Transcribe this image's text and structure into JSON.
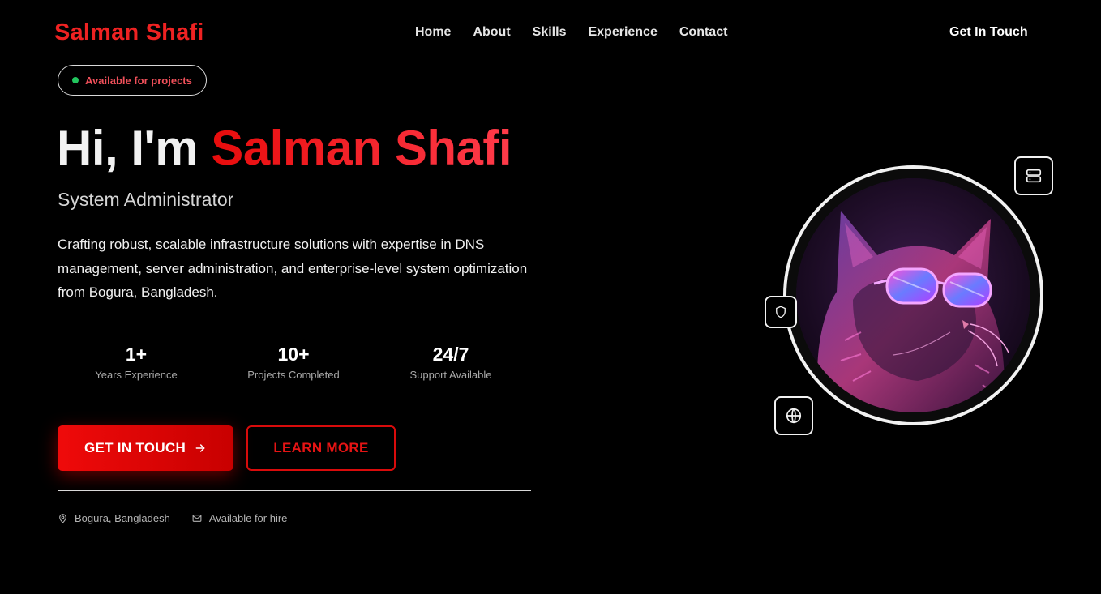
{
  "header": {
    "logo": "Salman Shafi",
    "nav": [
      "Home",
      "About",
      "Skills",
      "Experience",
      "Contact"
    ],
    "cta": "Get In Touch"
  },
  "badge": {
    "text": "Available for projects",
    "dot_color": "#22c55e"
  },
  "hero": {
    "greeting": "Hi, I'm ",
    "name": "Salman Shafi",
    "role": "System Administrator",
    "description": "Crafting robust, scalable infrastructure solutions with expertise in DNS management, server administration, and enterprise-level system optimization from Bogura, Bangladesh."
  },
  "stats": [
    {
      "value": "1+",
      "label": "Years Experience"
    },
    {
      "value": "10+",
      "label": "Projects Completed"
    },
    {
      "value": "24/7",
      "label": "Support Available"
    }
  ],
  "buttons": {
    "primary": "GET IN TOUCH",
    "secondary": "LEARN MORE"
  },
  "meta": {
    "location": "Bogura, Bangladesh",
    "availability": "Available for hire"
  },
  "icons": {
    "server": "server-icon",
    "shield": "shield-icon",
    "globe": "globe-icon",
    "avatar": "cat-with-glasses-avatar"
  },
  "colors": {
    "accent": "#ef2222",
    "background": "#000000"
  }
}
